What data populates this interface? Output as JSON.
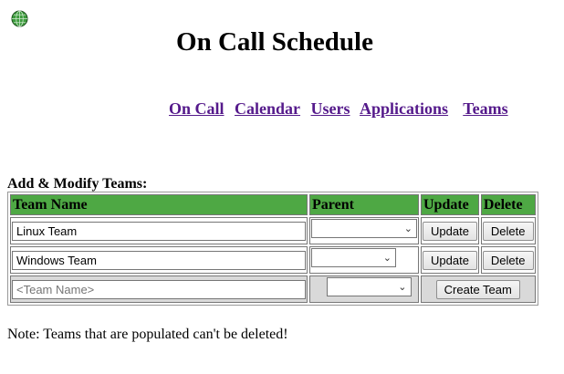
{
  "header": {
    "logo_icon": "globe-icon",
    "title": "On Call Schedule"
  },
  "nav": {
    "links": [
      "On Call",
      "Calendar",
      "Users",
      "Applications",
      "Teams"
    ]
  },
  "section": {
    "label": "Add & Modify Teams:"
  },
  "table": {
    "columns": [
      "Team Name",
      "Parent",
      "Update",
      "Delete"
    ],
    "rows": [
      {
        "team_name": "Linux Team",
        "parent": "",
        "update_label": "Update",
        "delete_label": "Delete"
      },
      {
        "team_name": "Windows Team",
        "parent": "",
        "update_label": "Update",
        "delete_label": "Delete"
      }
    ],
    "new_row": {
      "placeholder": "<Team Name>",
      "parent": "",
      "create_label": "Create Team"
    }
  },
  "note": "Note: Teams that are populated can't be deleted!",
  "colors": {
    "header_bg": "#4ea844",
    "link": "#551a8b"
  }
}
